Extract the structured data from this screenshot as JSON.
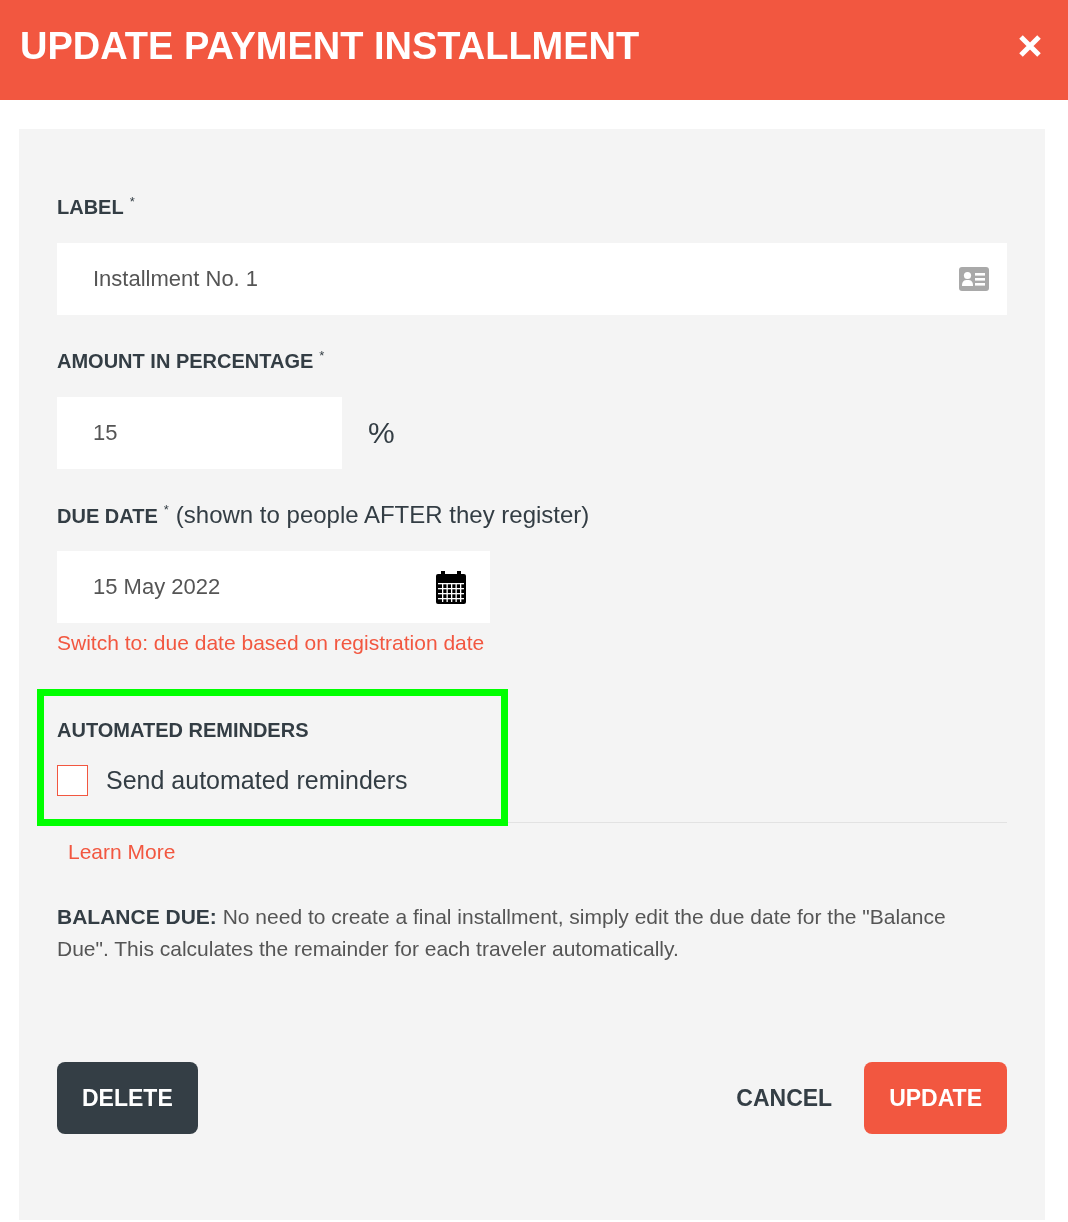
{
  "dialog": {
    "title": "UPDATE PAYMENT INSTALLMENT"
  },
  "fields": [
    {
      "kind": "text",
      "label": "LABEL",
      "required_mark": "*",
      "value": "Installment No. 1"
    },
    {
      "kind": "percent",
      "label": "AMOUNT IN PERCENTAGE",
      "required_mark": "*",
      "value": "15",
      "suffix": "%"
    },
    {
      "kind": "date",
      "label": "DUE DATE",
      "required_mark": "*",
      "note": "(shown to people AFTER they register)",
      "value": "15 May 2022",
      "link": "Switch to: due date based on registration date"
    }
  ],
  "reminders": {
    "heading": "AUTOMATED REMINDERS",
    "highlighted": true,
    "option": {
      "label": "Send automated reminders",
      "checked": false
    }
  },
  "learn_more": "Learn More",
  "balance_note": "**BALANCE DUE:** No need to create a final installment, simply edit the due date for the \"Balance Due\". This calculates the remainder for each traveler automatically.",
  "actions": [
    {
      "kind": "delete",
      "label": "DELETE"
    },
    {
      "kind": "cancel",
      "label": "CANCEL"
    },
    {
      "kind": "primary",
      "label": "UPDATE"
    }
  ]
}
